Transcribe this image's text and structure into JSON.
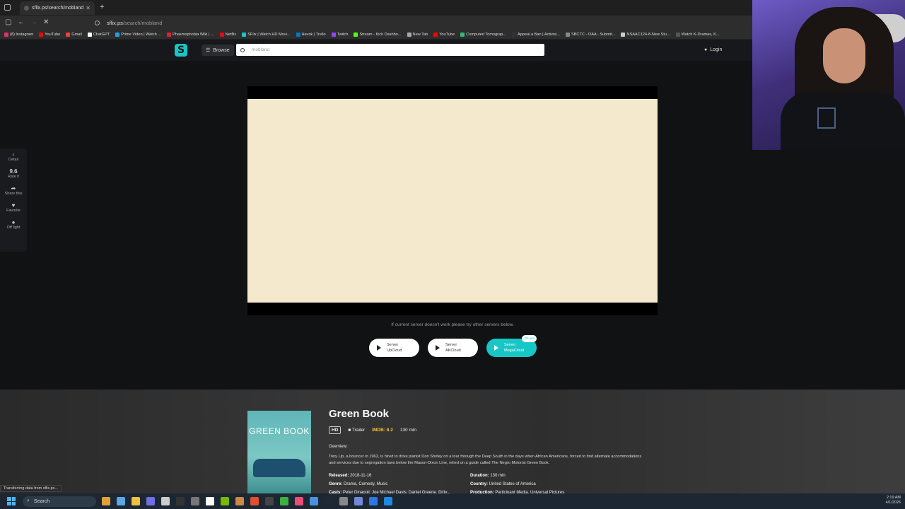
{
  "browser": {
    "tab_title": "sflix.ps/search/mobland",
    "url_host": "sflix.ps",
    "url_path": "/search/mobland",
    "bookmarks": [
      {
        "label": "(8) Instagram",
        "color": "#e1306c"
      },
      {
        "label": "YouTube",
        "color": "#ff0000"
      },
      {
        "label": "Gmail",
        "color": "#ea4335"
      },
      {
        "label": "ChatGPT",
        "color": "#ffffff"
      },
      {
        "label": "Prime Video | Watch ...",
        "color": "#1fa0e3"
      },
      {
        "label": "Phasmophobia Wiki | ...",
        "color": "#d23"
      },
      {
        "label": "Netflix",
        "color": "#e50914"
      },
      {
        "label": "SFlix | Watch HD Movi...",
        "color": "#18c6c6"
      },
      {
        "label": "Havok | Trello",
        "color": "#0079bf"
      },
      {
        "label": "Twitch",
        "color": "#9146ff"
      },
      {
        "label": "Stream - Kick Dashbo...",
        "color": "#53fc18"
      },
      {
        "label": "New Tab",
        "color": "#aaaaaa"
      },
      {
        "label": "YouTube",
        "color": "#ff0000"
      },
      {
        "label": "Computed Tomograp...",
        "color": "#3b7"
      },
      {
        "label": "Appeal a Ban | Activisi...",
        "color": "#333"
      },
      {
        "label": "SBCTC - OAA - Submit...",
        "color": "#888"
      },
      {
        "label": "NSAAC124-8-New Stu...",
        "color": "#ccc"
      },
      {
        "label": "Watch K-Dramas, K...",
        "color": "#555"
      }
    ],
    "status": "Transferring data from sflix.ps..."
  },
  "site": {
    "logo": "S",
    "browse": "Browse",
    "search_value": "mobland",
    "login": "Login"
  },
  "side": {
    "detail": "Detail",
    "rating": "9.6",
    "rate_it": "Rate it",
    "share": "Share this",
    "favorite": "Favorite",
    "off_light": "Off light"
  },
  "player": {
    "hint": "If current server doesn't work please try other servers below.",
    "servers": [
      {
        "line1": "Server",
        "line2": "UpCloud",
        "active": false
      },
      {
        "line1": "Server",
        "line2": "AKCloud",
        "active": false
      },
      {
        "line1": "Server",
        "line2": "MegaCloud",
        "active": true
      }
    ],
    "on_use": "On use"
  },
  "movie": {
    "poster_title": "GREEN BOOK",
    "title": "Green Book",
    "quality": "HD",
    "trailer": "Trailer",
    "imdb": "IMDB: 8.2",
    "duration_short": "130 min",
    "overview_label": "Overview:",
    "overview": "Tony Lip, a bouncer in 1962, is hired to drive pianist Don Shirley on a tour through the Deep South in the days when African Americans, forced to find alternate accommodations and services due to segregation laws below the Mason-Dixon Line, relied on a guide called The Negro Motorist Green Book.",
    "released_label": "Released:",
    "released": "2018-11-16",
    "genre_label": "Genre:",
    "genre": "Drama, Comedy, Music",
    "casts_label": "Casts:",
    "casts": "Peter Dinapoli, Joe Michael Davis, Daniel Greene, Dirty...",
    "duration_label": "Duration:",
    "duration": "130 min",
    "country_label": "Country:",
    "country": "United States of America",
    "production_label": "Production:",
    "production": "Participant Media, Universal Pictures"
  },
  "taskbar": {
    "search": "Search",
    "time": "2:19 AM",
    "date": "4/1/2026",
    "apps": [
      "#e0a03a",
      "#5aa7e6",
      "#f0c040",
      "#6f6fdf",
      "#cccccc",
      "#333333",
      "#777",
      "#ffffff",
      "#76b900",
      "#cc8844",
      "#e05030",
      "#444",
      "#3cb043",
      "#e94e77",
      "#4a90e2",
      "#1b2838",
      "#888",
      "#7289da",
      "#2b78e4",
      "#1e88e5"
    ]
  }
}
